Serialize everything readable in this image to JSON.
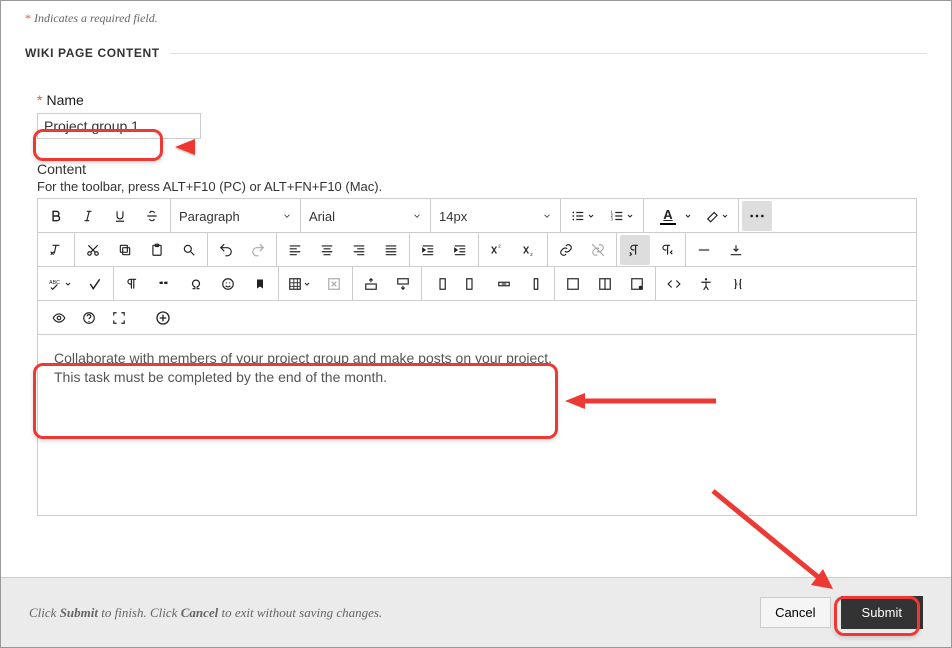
{
  "note": {
    "asterisk": "*",
    "text": "Indicates a required field."
  },
  "section_title": "WIKI PAGE CONTENT",
  "form": {
    "name_label": "Name",
    "name_value": "Project group 1",
    "content_label": "Content",
    "toolbar_hint": "For the toolbar, press ALT+F10 (PC) or ALT+FN+F10 (Mac)."
  },
  "toolbar": {
    "paragraph": "Paragraph",
    "font": "Arial",
    "size": "14px"
  },
  "editor": {
    "line1": "Collaborate with members of your project group and make posts on your project.",
    "line2": "This task must be completed by the end of the month."
  },
  "footer": {
    "text_prefix": "Click ",
    "submit_word": "Submit",
    "text_mid": " to finish. Click ",
    "cancel_word": "Cancel",
    "text_suffix": " to exit without saving changes.",
    "cancel": "Cancel",
    "submit": "Submit"
  }
}
